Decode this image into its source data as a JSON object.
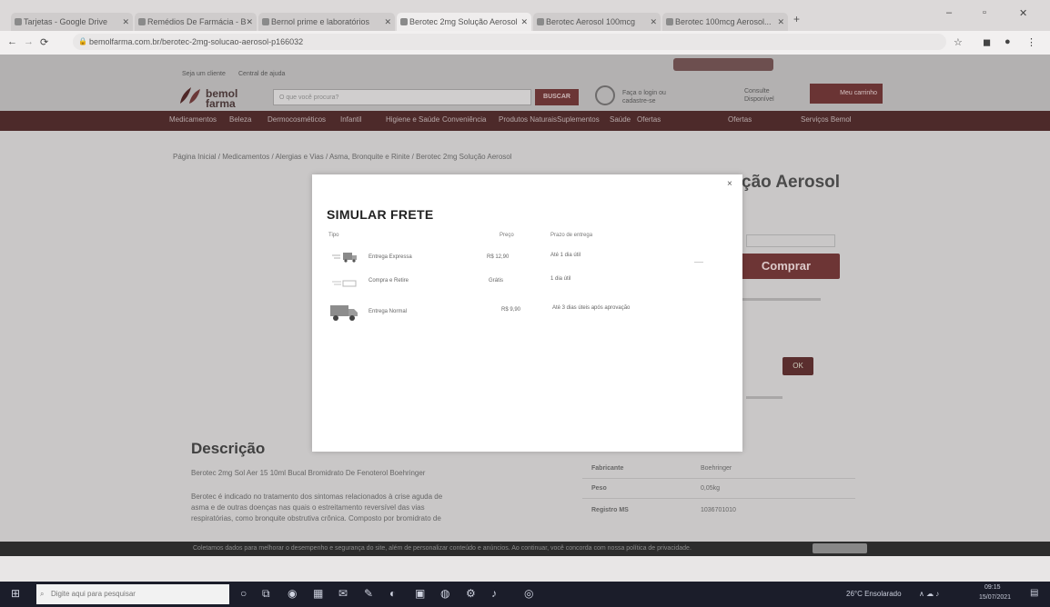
{
  "browser": {
    "tabs": [
      {
        "label": "Tarjetas - Google Drive"
      },
      {
        "label": "Remédios De Farmácia - Bem..."
      },
      {
        "label": "Bernol prime e laboratórios"
      },
      {
        "label": "Berotec 2mg Solução Aerosol"
      },
      {
        "label": "Berotec Aerosol 100mcg"
      },
      {
        "label": "Berotec 100mcg Aerosol..."
      }
    ],
    "new_tab": "+",
    "url": "bemolfarma.com.br/berotec-2mg-solucao-aerosol-p166032",
    "window_controls": [
      "–",
      "▫",
      "✕"
    ]
  },
  "site": {
    "top_links": [
      "Seja um cliente",
      "Central de ajuda"
    ],
    "logo": "bemol farma",
    "search_placeholder": "O que você procura?",
    "search_button": "BUSCAR",
    "login": "Faça o login ou cadastre-se",
    "whatsapp": "Consulte Disponível",
    "cart": "Meu carrinho",
    "nav": [
      "Medicamentos",
      "Beleza",
      "Dermocosméticos",
      "Infantil",
      "Higiene e Saúde",
      "Conveniência",
      "Produtos Naturais",
      "Suplementos",
      "Saúde",
      "Ofertas"
    ],
    "nav_right": [
      "Ofertas",
      "Serviços Bemol"
    ],
    "breadcrumb": "Página Inicial / Medicamentos / Alergias e Vias / Asma, Bronquite e Rinite / Berotec 2mg Solução Aerosol",
    "product_title_visible": "ção Aerosol",
    "buy_button": "Comprar",
    "ok_button": "OK",
    "description_heading": "Descrição",
    "description_lines": [
      "Berotec 2mg Sol Aer 15 10ml Bucal Bromidrato De Fenoterol Boehringer",
      "Berotec é indicado no tratamento dos sintomas relacionados à crise aguda de",
      "asma e de outras doenças nas quais o estreitamento reversível das vias",
      "respiratórias, como bronquite obstrutiva crônica. Composto por bromidrato de"
    ],
    "specs": [
      {
        "key": "Fabricante",
        "val": "Boehringer"
      },
      {
        "key": "Peso",
        "val": "0,05kg"
      },
      {
        "key": "Registro MS",
        "val": "1036701010"
      }
    ],
    "cookie_text": "Coletamos dados para melhorar o desempenho e segurança do site, além de personalizar conteúdo e anúncios. Ao continuar, você concorda com nossa política de privacidade."
  },
  "modal": {
    "title": "SIMULAR FRETE",
    "close": "×",
    "columns": [
      "Tipo",
      "Preço",
      "Prazo de entrega"
    ],
    "rows": [
      {
        "name": "Entrega Expressa",
        "price": "R$ 12,90",
        "eta": "Até 1 dia útil"
      },
      {
        "name": "Compra e Retire",
        "price": "Grátis",
        "eta": "1 dia útil"
      },
      {
        "name": "Entrega Normal",
        "price": "R$ 9,90",
        "eta": "Até 3 dias úteis após aprovação"
      }
    ]
  },
  "taskbar": {
    "search_placeholder": "Digite aqui para pesquisar",
    "weather": "26°C Ensolarado",
    "time": "09:15",
    "date": "15/07/2021"
  }
}
